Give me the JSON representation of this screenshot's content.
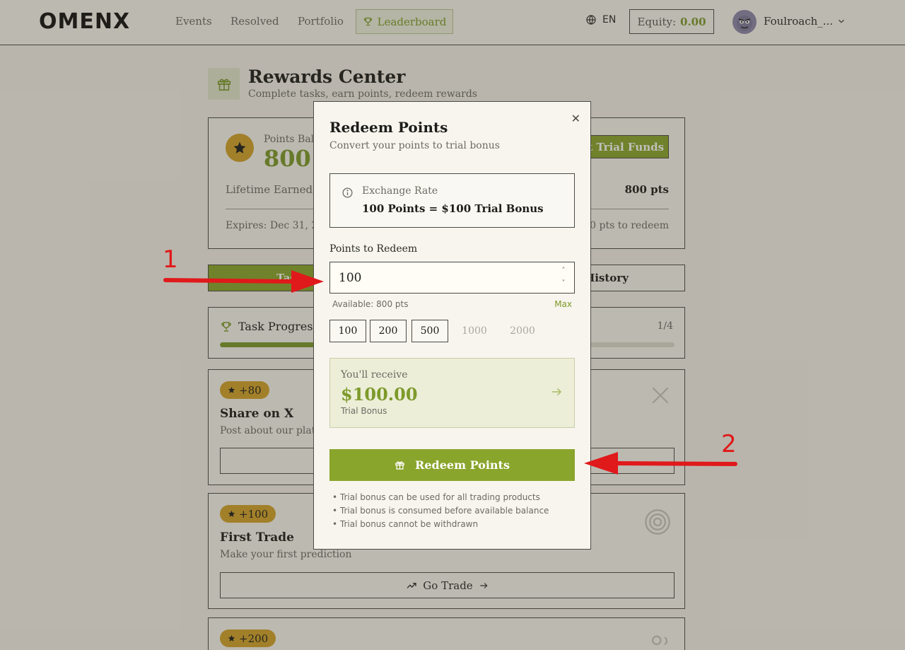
{
  "header": {
    "logo": "OMENX",
    "nav": [
      "Events",
      "Resolved",
      "Portfolio",
      "Leaderboard"
    ],
    "lang": "EN",
    "equity_label": "Equity:",
    "equity_value": "0.00",
    "username": "Foulroach_..."
  },
  "rewards": {
    "title": "Rewards Center",
    "subtitle": "Complete tasks, earn points, redeem rewards",
    "balance_label": "Points Bala",
    "balance_value": "800",
    "trial_funds_button": "et Trial Funds",
    "lifetime_label": "Lifetime Earned",
    "lifetime_value": "800 pts",
    "expires": "Expires: Dec 31, 20",
    "to_redeem": "00 pts to redeem"
  },
  "tabs": {
    "tasks": "Tas",
    "history": "History"
  },
  "progress": {
    "title": "Task Progress",
    "count": "1/4",
    "fill_fraction": 0.25
  },
  "tasks": [
    {
      "points": "+80",
      "title": "Share on X",
      "desc": "Post about our platf"
    },
    {
      "points": "+100",
      "title": "First Trade",
      "desc": "Make your first prediction",
      "action": "Go Trade"
    },
    {
      "points": "+200"
    }
  ],
  "modal": {
    "title": "Redeem Points",
    "subtitle": "Convert your points to trial bonus",
    "rate_label": "Exchange Rate",
    "rate_value": "100 Points = $100 Trial Bonus",
    "input_label": "Points to Redeem",
    "input_value": "100",
    "available": "Available: 800 pts",
    "max": "Max",
    "presets": [
      "100",
      "200",
      "500",
      "1000",
      "2000"
    ],
    "receive_label": "You'll receive",
    "receive_value": "$100.00",
    "receive_note": "Trial Bonus",
    "redeem_button": "Redeem Points",
    "notes": [
      "• Trial bonus can be used for all trading products",
      "• Trial bonus is consumed before available balance",
      "• Trial bonus cannot be withdrawn"
    ]
  },
  "annotations": [
    "1",
    "2"
  ],
  "colors": {
    "accent": "#8aa52c",
    "accent_text": "#7d9a2a",
    "gold": "#d3a22a",
    "annotation": "#e0191b"
  }
}
